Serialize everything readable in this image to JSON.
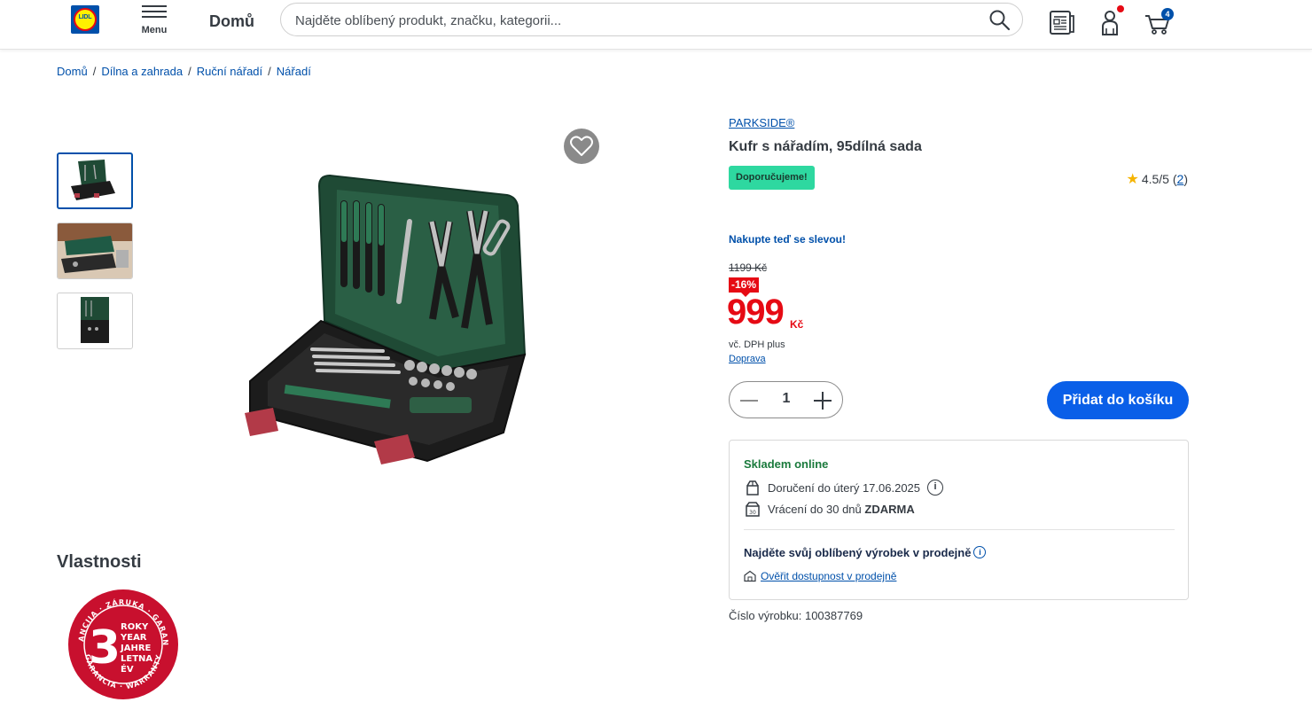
{
  "header": {
    "logo_text": "LIDL",
    "menu_label": "Menu",
    "home_label": "Domů",
    "search_placeholder": "Najděte oblíbený produkt, značku, kategorii...",
    "cart_count": "4"
  },
  "breadcrumb": {
    "items": [
      "Domů",
      "Dílna a zahrada",
      "Ruční nářadí",
      "Nářadí"
    ]
  },
  "product": {
    "brand": "PARKSIDE®",
    "title": "Kufr s nářadím, 95dílná sada",
    "badge": "Doporučujeme!",
    "rating_value": "4.5/5",
    "rating_count": "2",
    "promo": "Nakupte teď se slevou!",
    "old_price": "1199 Kč",
    "discount": "-16%",
    "price": "999",
    "currency": "Kč",
    "vat": "vč. DPH plus",
    "shipping": "Doprava",
    "quantity": "1",
    "add_to_cart": "Přidat do košíku",
    "item_number": "Číslo výrobku: 100387769"
  },
  "availability": {
    "stock": "Skladem online",
    "delivery": "Doručení do úterý 17.06.2025",
    "return_prefix": "Vrácení do 30 dnů",
    "return_free": "ZDARMA",
    "store_title": "Najděte svůj oblíbený výrobek v prodejně",
    "store_link": "Ověřit dostupnost v prodejně"
  },
  "properties": {
    "title": "Vlastnosti",
    "warranty_number": "3",
    "warranty_words": [
      "ROKY",
      "YEAR",
      "JAHRE",
      "LETNA",
      "ÉV"
    ],
    "warranty_ring_top": "GARANCIJA · ZÁRUKA · GARANTIE",
    "warranty_ring_bottom": "GARANCIA · WARRANTY"
  },
  "colors": {
    "brand_blue": "#0050aa",
    "cta_blue": "#0a5fe8",
    "price_red": "#e60a14",
    "badge_green": "#2ed8a0",
    "stock_green": "#1a7a3c"
  }
}
